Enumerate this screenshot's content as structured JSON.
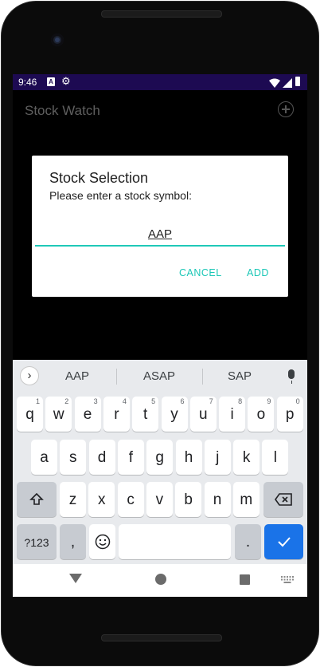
{
  "status_bar": {
    "time": "9:46",
    "icons": [
      "a-notification-icon",
      "gear-icon",
      "wifi-icon",
      "signal-icon",
      "battery-icon"
    ]
  },
  "app_bar": {
    "title": "Stock Watch",
    "action_icon": "add-circle-icon"
  },
  "dialog": {
    "title": "Stock Selection",
    "message": "Please enter a stock symbol:",
    "input_value": "AAP",
    "cancel_label": "CANCEL",
    "add_label": "ADD"
  },
  "keyboard": {
    "suggestions": [
      "AAP",
      "ASAP",
      "SAP"
    ],
    "row1": [
      {
        "label": "q",
        "hint": "1"
      },
      {
        "label": "w",
        "hint": "2"
      },
      {
        "label": "e",
        "hint": "3"
      },
      {
        "label": "r",
        "hint": "4"
      },
      {
        "label": "t",
        "hint": "5"
      },
      {
        "label": "y",
        "hint": "6"
      },
      {
        "label": "u",
        "hint": "7"
      },
      {
        "label": "i",
        "hint": "8"
      },
      {
        "label": "o",
        "hint": "9"
      },
      {
        "label": "p",
        "hint": "0"
      }
    ],
    "row2": [
      "a",
      "s",
      "d",
      "f",
      "g",
      "h",
      "j",
      "k",
      "l"
    ],
    "row3": [
      "z",
      "x",
      "c",
      "v",
      "b",
      "n",
      "m"
    ],
    "symbols_label": "?123",
    "comma_label": ",",
    "period_label": ".",
    "icons": [
      "shift-icon",
      "backspace-icon",
      "emoji-icon",
      "enter-check-icon",
      "mic-icon",
      "expand-suggestions-icon"
    ]
  },
  "nav_bar": {
    "icons": [
      "back-icon",
      "home-icon",
      "recents-icon",
      "keyboard-switch-icon"
    ]
  },
  "colors": {
    "accent": "#1bc7b6",
    "status_bar": "#1d0a52",
    "keyboard_bg": "#e8eaed",
    "enter_key": "#1a73e8"
  }
}
